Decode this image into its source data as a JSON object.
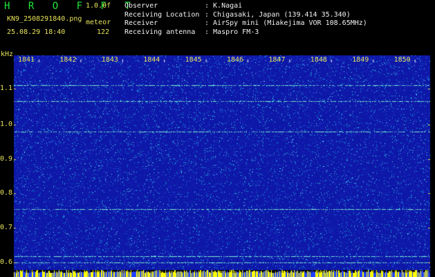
{
  "header": {
    "app_title": "H R O F F T",
    "version": "1.0.0f",
    "filename": "KN9_2508291840.png",
    "mode": "meteor",
    "datetime": "25.08.29 18:40",
    "count": "122"
  },
  "info": [
    {
      "label": "Observer",
      "value": ": K.Nagai"
    },
    {
      "label": "Receiving Location",
      "value": ": Chigasaki, Japan (139.414 35.340)"
    },
    {
      "label": "Receiver",
      "value": ": AirSpy mini (Miakejima VOR 108.65MHz)"
    },
    {
      "label": "Receiving antenna",
      "value": ": Maspro FM-3"
    }
  ],
  "spectrogram": {
    "unit": "kHz",
    "freq_labels": [
      "1.1",
      "1.0",
      "0.9",
      "0.8",
      "0.7",
      "0.6"
    ],
    "time_labels": [
      "1841",
      "1842",
      "1843",
      "1844",
      "1845",
      "1846",
      "1847",
      "1848",
      "1849",
      "1850"
    ],
    "colors": {
      "background": "#0e18a8",
      "noise": "#10b8e0",
      "trace": "#7af0d0",
      "baseline": "#ffff00"
    }
  }
}
